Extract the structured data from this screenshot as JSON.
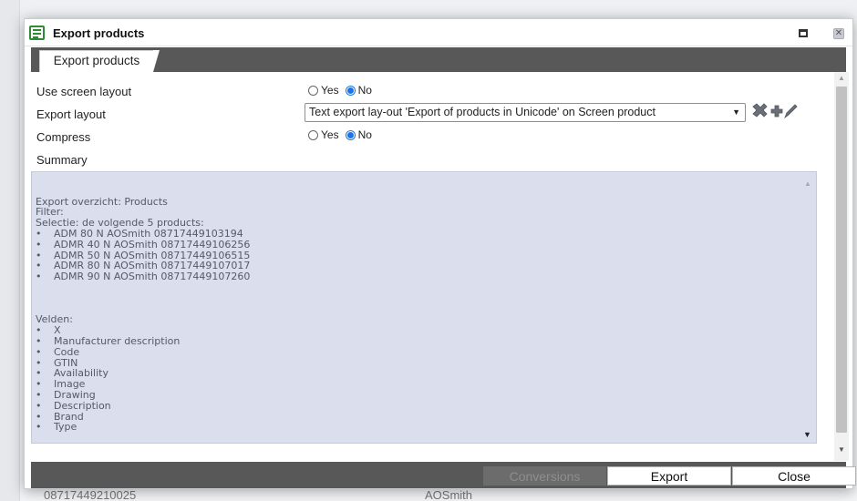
{
  "background": {
    "bottom_text_left": "087174492100​25",
    "bottom_text_right": "AOSmith"
  },
  "dialog": {
    "title": "Export products",
    "tab_label": "Export products",
    "use_screen_layout": {
      "label": "Use screen layout",
      "yes_label": "Yes",
      "no_label": "No",
      "selected": "No"
    },
    "export_layout": {
      "label": "Export layout",
      "selected": "Text export lay-out 'Export of products in Unicode' on Screen product",
      "tools": [
        "delete-icon",
        "add-icon",
        "edit-icon"
      ]
    },
    "compress": {
      "label": "Compress",
      "yes_label": "Yes",
      "no_label": "No",
      "selected": "No"
    },
    "summary_label": "Summary",
    "summary_lines": [
      {
        "bullet": "",
        "text": "Export overzicht: Products"
      },
      {
        "bullet": "",
        "text": "Filter:"
      },
      {
        "bullet": "",
        "text": "Selectie: de volgende 5 products:"
      },
      {
        "bullet": "•",
        "text": "ADM 80 N AOSmith 08717449103194"
      },
      {
        "bullet": "•",
        "text": "ADMR 40 N AOSmith 08717449106256"
      },
      {
        "bullet": "•",
        "text": "ADMR 50 N AOSmith 08717449106515"
      },
      {
        "bullet": "•",
        "text": "ADMR 80 N AOSmith 08717449107017"
      },
      {
        "bullet": "•",
        "text": "ADMR 90 N AOSmith 08717449107260"
      },
      {
        "bullet": "",
        "text": ""
      },
      {
        "bullet": "",
        "text": ""
      },
      {
        "bullet": "",
        "text": ""
      },
      {
        "bullet": "",
        "text": "Velden:"
      },
      {
        "bullet": "•",
        "text": "X"
      },
      {
        "bullet": "•",
        "text": "Manufacturer description"
      },
      {
        "bullet": "•",
        "text": "Code"
      },
      {
        "bullet": "•",
        "text": "GTIN"
      },
      {
        "bullet": "•",
        "text": "Availability"
      },
      {
        "bullet": "•",
        "text": "Image"
      },
      {
        "bullet": "•",
        "text": "Drawing"
      },
      {
        "bullet": "•",
        "text": "Description"
      },
      {
        "bullet": "•",
        "text": "Brand"
      },
      {
        "bullet": "•",
        "text": "Type"
      }
    ],
    "buttons": {
      "conversions": "Conversions",
      "export": "Export",
      "close": "Close"
    }
  },
  "colors": {
    "header_bar": "#585858",
    "summary_bg": "#dadeed",
    "radio_accent": "#1a73e8",
    "app_icon": "#2f8c35"
  }
}
